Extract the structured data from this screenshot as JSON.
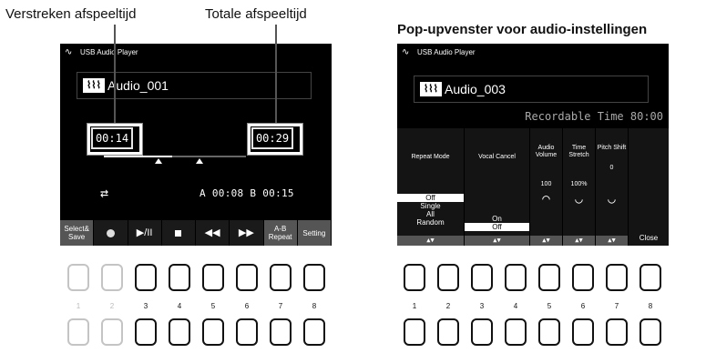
{
  "annotations": {
    "elapsed": "Verstreken afspeeltijd",
    "total": "Totale afspeeltijd",
    "popup_heading": "Pop-upvenster voor audio-instellingen"
  },
  "left_screen": {
    "title": "USB Audio Player",
    "song": "Audio_001",
    "elapsed_time": "00:14",
    "total_time": "00:29",
    "progress_fraction": 0.48,
    "ab_text": "A 00:08  B 00:15",
    "softkeys": {
      "select_save": "Select& Save",
      "ab_repeat": "A-B Repeat",
      "setting": "Setting"
    }
  },
  "right_screen": {
    "title": "USB Audio Player",
    "song": "Audio_003",
    "recordable": "Recordable Time 80:00",
    "repeat_mode": {
      "label": "Repeat Mode",
      "options": [
        "Off",
        "Single",
        "All",
        "Random"
      ],
      "selected": "Off"
    },
    "vocal_cancel": {
      "label": "Vocal Cancel",
      "options": [
        "On",
        "Off"
      ],
      "selected": "Off"
    },
    "audio_volume": {
      "label": "Audio Volume",
      "value": "100"
    },
    "time_stretch": {
      "label": "Time Stretch",
      "value": "100%"
    },
    "pitch_shift": {
      "label": "Pitch Shift",
      "value": "0"
    },
    "close_label": "Close",
    "arrows": "▲▼"
  },
  "button_numbers": [
    "1",
    "2",
    "3",
    "4",
    "5",
    "6",
    "7",
    "8"
  ],
  "icons": {
    "app": "wave-logo-icon",
    "repeat": "repeat-icon",
    "record": "record-icon",
    "play_pause": "play-pause-icon",
    "stop": "stop-icon",
    "rewind": "rewind-icon",
    "fast_forward": "fast-forward-icon"
  }
}
